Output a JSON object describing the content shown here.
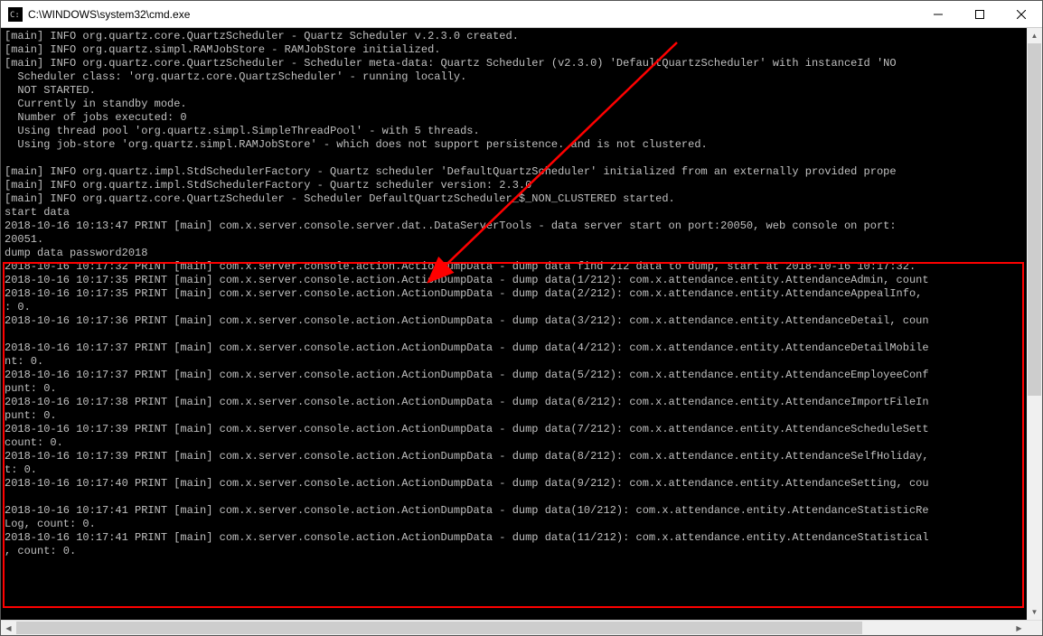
{
  "title": "C:\\WINDOWS\\system32\\cmd.exe",
  "lines": [
    "[main] INFO org.quartz.core.QuartzScheduler - Quartz Scheduler v.2.3.0 created.",
    "[main] INFO org.quartz.simpl.RAMJobStore - RAMJobStore initialized.",
    "[main] INFO org.quartz.core.QuartzScheduler - Scheduler meta-data: Quartz Scheduler (v2.3.0) 'DefaultQuartzScheduler' with instanceId 'NO",
    "  Scheduler class: 'org.quartz.core.QuartzScheduler' - running locally.",
    "  NOT STARTED.",
    "  Currently in standby mode.",
    "  Number of jobs executed: 0",
    "  Using thread pool 'org.quartz.simpl.SimpleThreadPool' - with 5 threads.",
    "  Using job-store 'org.quartz.simpl.RAMJobStore' - which does not support persistence. and is not clustered.",
    "",
    "[main] INFO org.quartz.impl.StdSchedulerFactory - Quartz scheduler 'DefaultQuartzScheduler' initialized from an externally provided prope",
    "[main] INFO org.quartz.impl.StdSchedulerFactory - Quartz scheduler version: 2.3.0",
    "[main] INFO org.quartz.core.QuartzScheduler - Scheduler DefaultQuartzScheduler_$_NON_CLUSTERED started.",
    "start data",
    "2018-10-16 10:13:47 PRINT [main] com.x.server.console.server.dat..DataServerTools - data server start on port:20050, web console on port:",
    "20051.",
    "dump data password2018",
    "2018-10-16 10:17:32 PRINT [main] com.x.server.console.action.ActionDumpData - dump data find 212 data to dump, start at 2018-10-16 10:17:32.",
    "2018-10-16 10:17:35 PRINT [main] com.x.server.console.action.ActionDumpData - dump data(1/212): com.x.attendance.entity.AttendanceAdmin, count",
    "2018-10-16 10:17:35 PRINT [main] com.x.server.console.action.ActionDumpData - dump data(2/212): com.x.attendance.entity.AttendanceAppealInfo,",
    ": 0.",
    "2018-10-16 10:17:36 PRINT [main] com.x.server.console.action.ActionDumpData - dump data(3/212): com.x.attendance.entity.AttendanceDetail, coun",
    "",
    "2018-10-16 10:17:37 PRINT [main] com.x.server.console.action.ActionDumpData - dump data(4/212): com.x.attendance.entity.AttendanceDetailMobile",
    "nt: 0.",
    "2018-10-16 10:17:37 PRINT [main] com.x.server.console.action.ActionDumpData - dump data(5/212): com.x.attendance.entity.AttendanceEmployeeConf",
    "punt: 0.",
    "2018-10-16 10:17:38 PRINT [main] com.x.server.console.action.ActionDumpData - dump data(6/212): com.x.attendance.entity.AttendanceImportFileIn",
    "punt: 0.",
    "2018-10-16 10:17:39 PRINT [main] com.x.server.console.action.ActionDumpData - dump data(7/212): com.x.attendance.entity.AttendanceScheduleSett",
    "count: 0.",
    "2018-10-16 10:17:39 PRINT [main] com.x.server.console.action.ActionDumpData - dump data(8/212): com.x.attendance.entity.AttendanceSelfHoliday,",
    "t: 0.",
    "2018-10-16 10:17:40 PRINT [main] com.x.server.console.action.ActionDumpData - dump data(9/212): com.x.attendance.entity.AttendanceSetting, cou",
    "",
    "2018-10-16 10:17:41 PRINT [main] com.x.server.console.action.ActionDumpData - dump data(10/212): com.x.attendance.entity.AttendanceStatisticRe",
    "Log, count: 0.",
    "2018-10-16 10:17:41 PRINT [main] com.x.server.console.action.ActionDumpData - dump data(11/212): com.x.attendance.entity.AttendanceStatistical",
    ", count: 0."
  ],
  "annotation": {
    "highlight_box": "red-outline-around-dump-section",
    "arrow": "red-arrow-pointing-to-action-dump-data-line"
  }
}
